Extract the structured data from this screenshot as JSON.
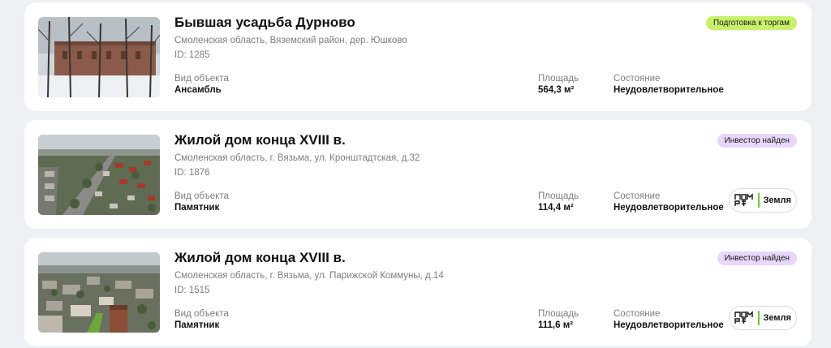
{
  "listings": [
    {
      "title": "Бывшая усадьба Дурново",
      "address": "Смоленская область, Вяземский район, дер. Юшково",
      "id_text": "ID: 1285",
      "status": "Подготовка к торгам",
      "status_color": "#c9f06a",
      "fields": [
        {
          "label": "Вид объекта",
          "value": "Ансамбль"
        },
        {
          "label": "Площадь",
          "value": "564,3 м²"
        },
        {
          "label": "Состояние",
          "value": "Неудовлетворительное"
        }
      ],
      "image_subject": "snowy-manor-ruins"
    },
    {
      "title": "Жилой дом конца XVIII в.",
      "address": "Смоленская область, г. Вязьма, ул. Кронштадтская, д.32",
      "id_text": "ID: 1876",
      "status": "Инвестор найден",
      "status_color": "#e6d7fb",
      "fields": [
        {
          "label": "Вид объекта",
          "value": "Памятник"
        },
        {
          "label": "Площадь",
          "value": "114,4 м²"
        },
        {
          "label": "Состояние",
          "value": "Неудовлетворительное"
        }
      ],
      "partner": {
        "label": "Земля",
        "icon": "dom-rf-logo-icon"
      },
      "image_subject": "aerial-town-road"
    },
    {
      "title": "Жилой дом конца XVIII в.",
      "address": "Смоленская область, г. Вязьма, ул. Парижской Коммуны, д.14",
      "id_text": "ID: 1515",
      "status": "Инвестор найден",
      "status_color": "#e6d7fb",
      "fields": [
        {
          "label": "Вид объекта",
          "value": "Памятник"
        },
        {
          "label": "Площадь",
          "value": "111,6 м²"
        },
        {
          "label": "Состояние",
          "value": "Неудовлетворительное"
        }
      ],
      "partner": {
        "label": "Земля",
        "icon": "dom-rf-logo-icon"
      },
      "image_subject": "aerial-town-buildings"
    }
  ]
}
